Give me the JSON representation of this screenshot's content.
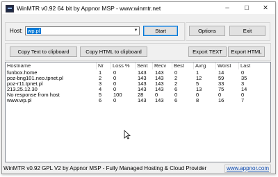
{
  "window": {
    "title": "WinMTR v0.92 64 bit by Appnor MSP - www.winmtr.net",
    "controls": {
      "minimize": "–",
      "maximize": "☐",
      "close": "✕"
    }
  },
  "toolbar": {
    "host_label": "Host:",
    "host_value": "wp.pl",
    "start_label": "Start",
    "options_label": "Options",
    "exit_label": "Exit"
  },
  "export_bar": {
    "copy_text_label": "Copy Text to clipboard",
    "copy_html_label": "Copy HTML to clipboard",
    "export_text_label": "Export TEXT",
    "export_html_label": "Export HTML"
  },
  "table": {
    "columns": [
      "Hostname",
      "Nr",
      "Loss %",
      "Sent",
      "Recv",
      "Best",
      "Avrg",
      "Worst",
      "Last"
    ],
    "rows": [
      [
        "funbox.home",
        "1",
        "0",
        "143",
        "143",
        "0",
        "1",
        "14",
        "0"
      ],
      [
        "poz-bng101.neo.tpnet.pl",
        "2",
        "0",
        "143",
        "143",
        "2",
        "12",
        "59",
        "35"
      ],
      [
        "poz-r11.tpnet.pl",
        "3",
        "0",
        "143",
        "143",
        "2",
        "5",
        "33",
        "3"
      ],
      [
        "213.25.12.30",
        "4",
        "0",
        "143",
        "143",
        "6",
        "13",
        "75",
        "14"
      ],
      [
        "No response from host",
        "5",
        "100",
        "28",
        "0",
        "0",
        "0",
        "0",
        "0"
      ],
      [
        "www.wp.pl",
        "6",
        "0",
        "143",
        "143",
        "6",
        "8",
        "16",
        "7"
      ]
    ]
  },
  "status_bar": {
    "text": "WinMTR v0.92 GPL V2 by Appnor MSP - Fully Managed Hosting & Cloud Provider",
    "link": "www.appnor.com"
  },
  "colors": {
    "accent": "#0078d7",
    "link": "#0645ad"
  }
}
